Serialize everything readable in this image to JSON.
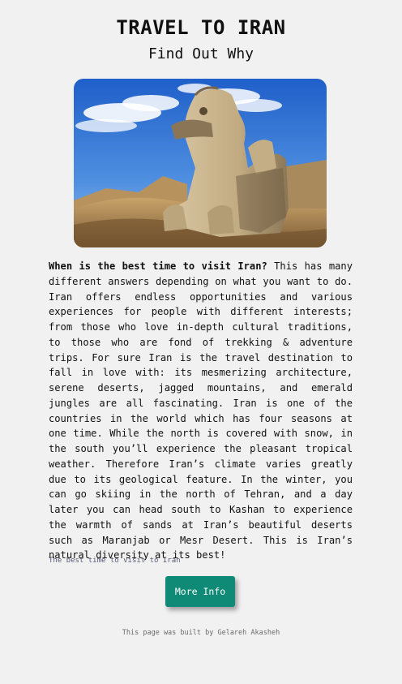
{
  "header": {
    "title": "TRAVEL TO IRAN",
    "subtitle": "Find Out Why"
  },
  "hero_image": {
    "icon": "persepolis-griffin-statue-photo"
  },
  "article": {
    "lead": "When is the best time to visit Iran?",
    "body": " This has many different answers depending on what you want to do. Iran offers endless opportunities and various experiences for people with different interests; from those who love in-depth cultural traditions, to those who are fond of trekking & adventure trips. For sure Iran is the travel destination to fall in love with: its mesmerizing architecture, serene deserts, jagged mountains, and emerald jungles are all fascinating. Iran is one of the countries in the world which has four seasons at one time. While the north is covered with snow, in the south you’ll experience the pleasant tropical weather. Therefore Iran’s climate varies greatly due to its geological feature. In the winter, you can go skiing in the north of Tehran, and a day later you can head south to Kashan to experience the warmth of sands at Iran’s beautiful deserts such as Maranjab or Mesr Desert. This is Iran’s natural diversity at its best!"
  },
  "caption": "The best time to visit to Iran",
  "button": {
    "label": "More Info",
    "color": "#0e8a76"
  },
  "footer": "This page was built by Gelareh Akasheh"
}
